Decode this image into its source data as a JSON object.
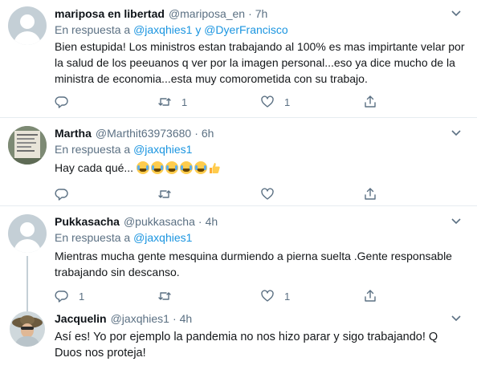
{
  "tweets": [
    {
      "name": "mariposa en libertad",
      "handle": "@mariposa_en",
      "sep": "·",
      "time": "7h",
      "reply_prefix": "En respuesta a",
      "reply_user1": "@jaxqhies1",
      "reply_joiner": "y",
      "reply_user2": "@DyerFrancisco",
      "text": "Bien estupida! Los ministros estan trabajando al 100% es mas impirtante velar por la salud de los peeuanos q ver por la imagen personal...eso ya dice mucho de la ministra de economia...esta muy comorometida con su trabajo.",
      "replies": "",
      "retweets": "1",
      "likes": "1"
    },
    {
      "name": "Martha",
      "handle": "@Marthit63973680",
      "sep": "·",
      "time": "6h",
      "reply_prefix": "En respuesta a",
      "reply_user1": "@jaxqhies1",
      "text": "Hay cada qué...",
      "emojis": [
        "face-with-tears-of-joy",
        "face-with-tears-of-joy",
        "face-with-tears-of-joy",
        "face-with-tears-of-joy",
        "face-with-tears-of-joy",
        "thumbs-up"
      ],
      "replies": "",
      "retweets": "",
      "likes": ""
    },
    {
      "name": "Pukkasacha",
      "handle": "@pukkasacha",
      "sep": "·",
      "time": "4h",
      "reply_prefix": "En respuesta a",
      "reply_user1": "@jaxqhies1",
      "text": "Mientras mucha gente mesquina durmiendo a pierna suelta .Gente responsable trabajando sin descanso.",
      "replies": "1",
      "retweets": "",
      "likes": "1"
    },
    {
      "name": "Jacquelin",
      "handle": "@jaxqhies1",
      "sep": "·",
      "time": "4h",
      "text": "Así es! Yo por ejemplo la pandemia no nos hizo parar y sigo trabajando! Q Duos nos proteja!"
    }
  ],
  "icons": {
    "reply": "reply-icon",
    "retweet": "retweet-icon",
    "like": "heart-icon",
    "share": "share-icon",
    "more": "chevron-down-icon"
  },
  "colors": {
    "link": "#1b95e0",
    "secondary_text": "#5b7083",
    "divider": "#e6ecf0"
  }
}
